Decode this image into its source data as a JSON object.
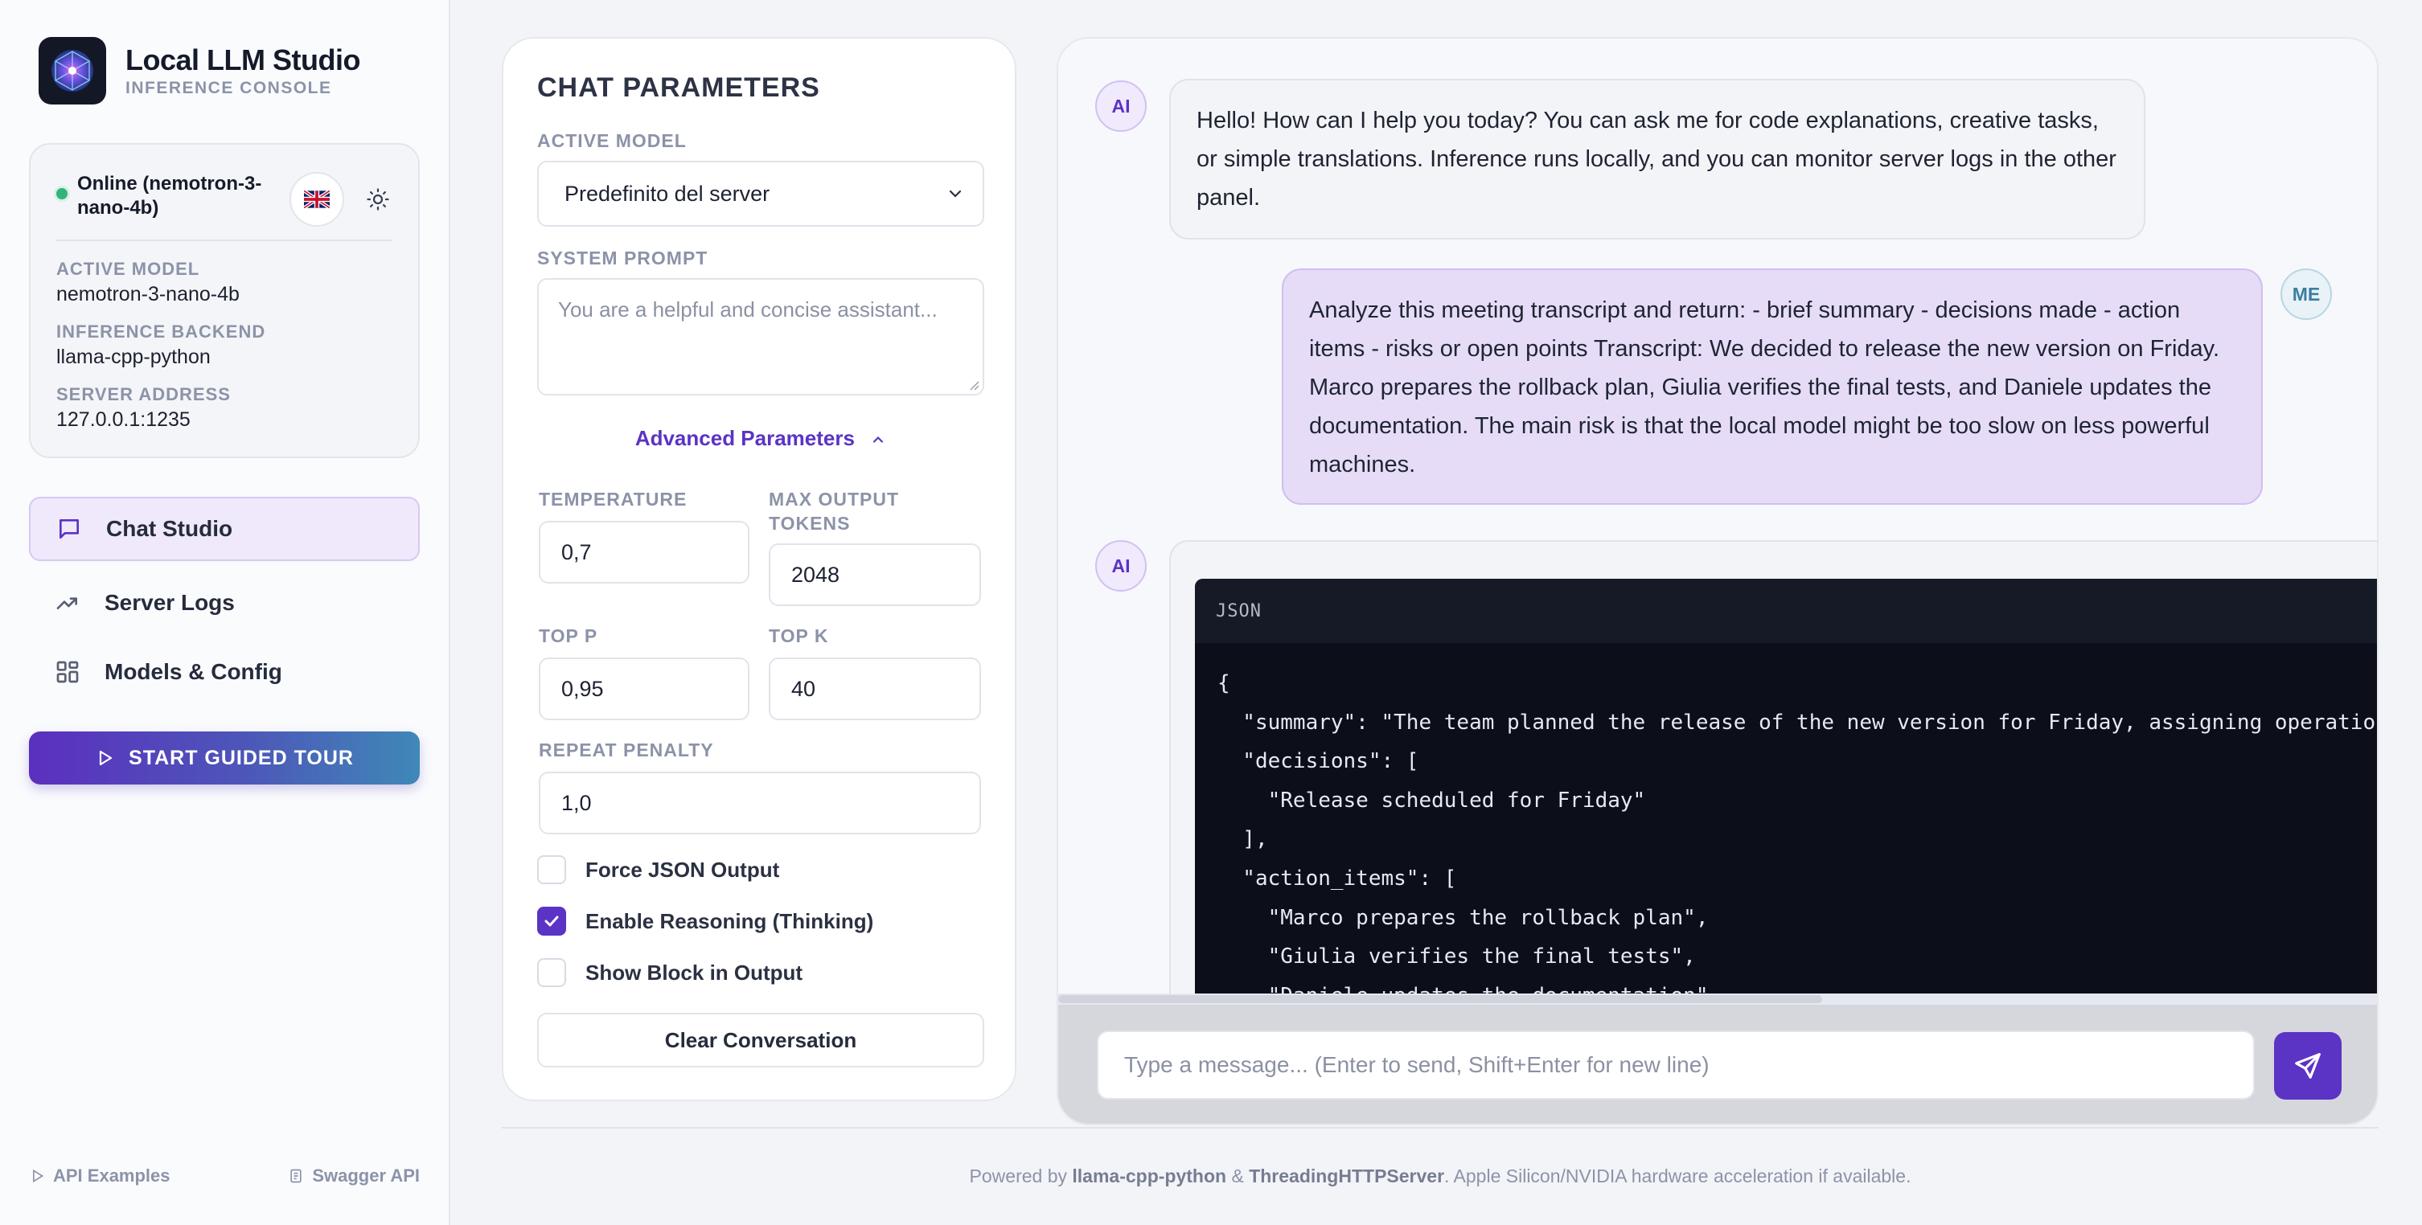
{
  "brand": {
    "title": "Local LLM Studio",
    "subtitle": "INFERENCE CONSOLE"
  },
  "status": {
    "text": "Online (nemotron-3-nano-4b)",
    "active_model_label": "ACTIVE MODEL",
    "active_model_value": "nemotron-3-nano-4b",
    "backend_label": "INFERENCE BACKEND",
    "backend_value": "llama-cpp-python",
    "address_label": "SERVER ADDRESS",
    "address_value": "127.0.0.1:1235",
    "flag_icon": "uk-flag-icon",
    "theme_icon": "sun-icon"
  },
  "nav": [
    {
      "label": "Chat Studio",
      "icon": "chat-bubble-icon",
      "active": true
    },
    {
      "label": "Server Logs",
      "icon": "trend-icon",
      "active": false
    },
    {
      "label": "Models & Config",
      "icon": "grid-icon",
      "active": false
    }
  ],
  "tour_button": "START GUIDED TOUR",
  "side_footer": {
    "api_examples": "API Examples",
    "swagger": "Swagger API"
  },
  "params": {
    "title": "CHAT PARAMETERS",
    "active_model_label": "ACTIVE MODEL",
    "active_model_value": "Predefinito del server",
    "system_prompt_label": "SYSTEM PROMPT",
    "system_prompt_placeholder": "You are a helpful and concise assistant...",
    "advanced_toggle": "Advanced Parameters",
    "temperature_label": "TEMPERATURE",
    "temperature_value": "0,7",
    "max_tokens_label_1": "MAX OUTPUT",
    "max_tokens_label_2": "TOKENS",
    "max_tokens_value": "2048",
    "top_p_label": "TOP P",
    "top_p_value": "0,95",
    "top_k_label": "TOP K",
    "top_k_value": "40",
    "repeat_penalty_label": "REPEAT PENALTY",
    "repeat_penalty_value": "1,0",
    "force_json_label": "Force JSON Output",
    "force_json_checked": false,
    "reasoning_label": "Enable Reasoning (Thinking)",
    "reasoning_checked": true,
    "show_block_label": "Show Block in Output",
    "show_block_checked": false,
    "clear_button": "Clear Conversation"
  },
  "chat": {
    "ai_avatar": "AI",
    "me_avatar": "ME",
    "messages": [
      {
        "role": "ai",
        "text": "Hello! How can I help you today? You can ask me for code explanations, creative tasks, or simple translations. Inference runs locally, and you can monitor server logs in the other panel."
      },
      {
        "role": "me",
        "text": "Analyze this meeting transcript and return: - brief summary - decisions made - action items - risks or open points Transcript: We decided to release the new version on Friday. Marco prepares the rollback plan, Giulia verifies the final tests, and Daniele updates the documentation. The main risk is that the local model might be too slow on less powerful machines."
      }
    ],
    "code_language": "JSON",
    "code_lines": [
      "{",
      "  \"summary\": \"The team planned the release of the new version for Friday, assigning operationa",
      "  \"decisions\": [",
      "    \"Release scheduled for Friday\"",
      "  ],",
      "  \"action_items\": [",
      "    \"Marco prepares the rollback plan\",",
      "    \"Giulia verifies the final tests\",",
      "    \"Daniele updates the documentation\""
    ],
    "input_placeholder": "Type a message... (Enter to send, Shift+Enter for new line)"
  },
  "footer": {
    "powered_by": "Powered by ",
    "lib1": "llama-cpp-python",
    "amp": " & ",
    "lib2": "ThreadingHTTPServer",
    "rest": ". Apple Silicon/NVIDIA hardware acceleration if available."
  },
  "colors": {
    "accent": "#5b33c5",
    "online": "#34b37a",
    "code_bg": "#0c0f1a"
  }
}
